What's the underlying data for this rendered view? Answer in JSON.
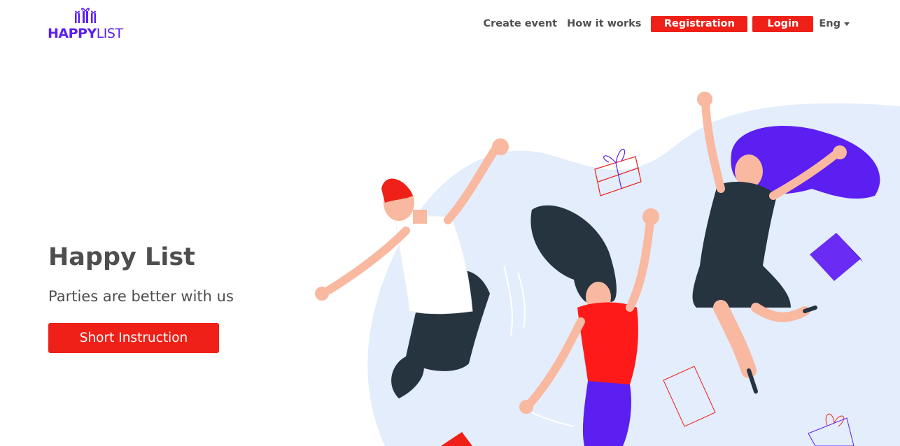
{
  "logo": {
    "bold": "HAPPY",
    "light": "LIST",
    "icon": "gift-boxes-icon"
  },
  "nav": {
    "create_event": "Create event",
    "how_it_works": "How it works",
    "registration": "Registration",
    "login": "Login",
    "language": "Eng"
  },
  "hero": {
    "title": "Happy List",
    "subtitle": "Parties are better with us",
    "cta": "Short Instruction"
  },
  "colors": {
    "accent_red": "#ee2018",
    "brand_purple": "#5b1ff2",
    "blob": "#e3edfb",
    "text": "#4e4e4e"
  },
  "illustration": {
    "icon": "jumping-people-illustration"
  }
}
